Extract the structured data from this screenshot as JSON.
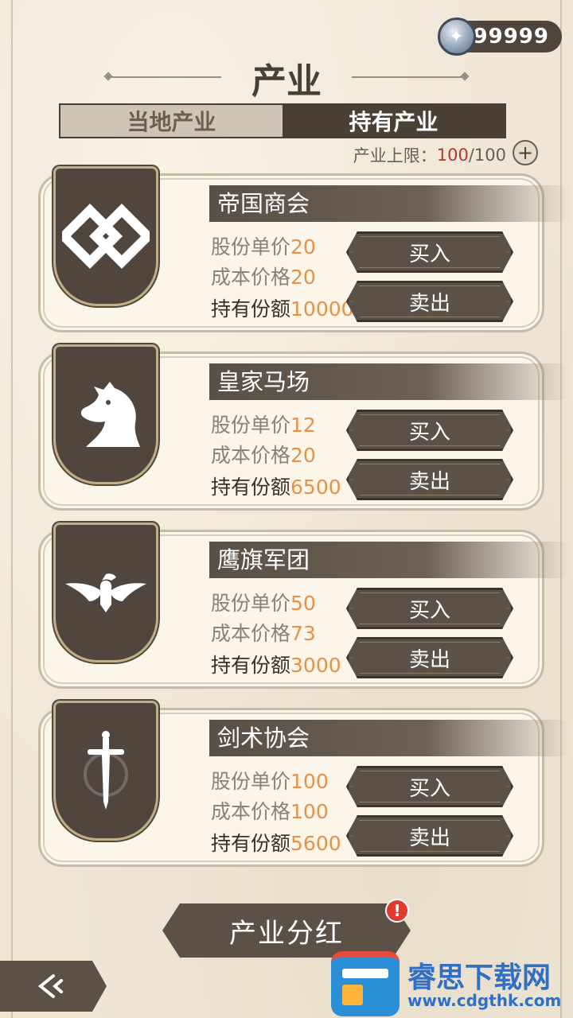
{
  "currency": {
    "amount": "99999",
    "icon": "silver-star-coin-icon"
  },
  "title": "产业",
  "tabs": [
    {
      "label": "当地产业",
      "active": false
    },
    {
      "label": "持有产业",
      "active": true
    }
  ],
  "limit": {
    "label": "产业上限：",
    "current": "100",
    "sep": "/",
    "max": "100"
  },
  "labels": {
    "price": "股份单价",
    "cost": "成本价格",
    "hold": "持有份额",
    "buy": "买入",
    "sell": "卖出"
  },
  "industries": [
    {
      "name": "帝国商会",
      "price": "20",
      "cost": "20",
      "hold": "10000",
      "icon": "interlocked-diamond-icon"
    },
    {
      "name": "皇家马场",
      "price": "12",
      "cost": "20",
      "hold": "6500",
      "icon": "horse-head-icon"
    },
    {
      "name": "鹰旗军团",
      "price": "50",
      "cost": "73",
      "hold": "3000",
      "icon": "eagle-icon"
    },
    {
      "name": "剑术协会",
      "price": "100",
      "cost": "100",
      "hold": "5600",
      "icon": "sword-icon"
    }
  ],
  "dividend": {
    "label": "产业分红",
    "alert": "!"
  },
  "back": {
    "icon": "back-arrow-icon"
  },
  "watermark": {
    "text": "睿思下载网",
    "url": "www.cdgthk.com"
  },
  "colors": {
    "accent_orange": "#e59148",
    "limit_red": "#b9362a",
    "dark_brown": "#5c5147",
    "alert_red": "#e23a2c"
  }
}
